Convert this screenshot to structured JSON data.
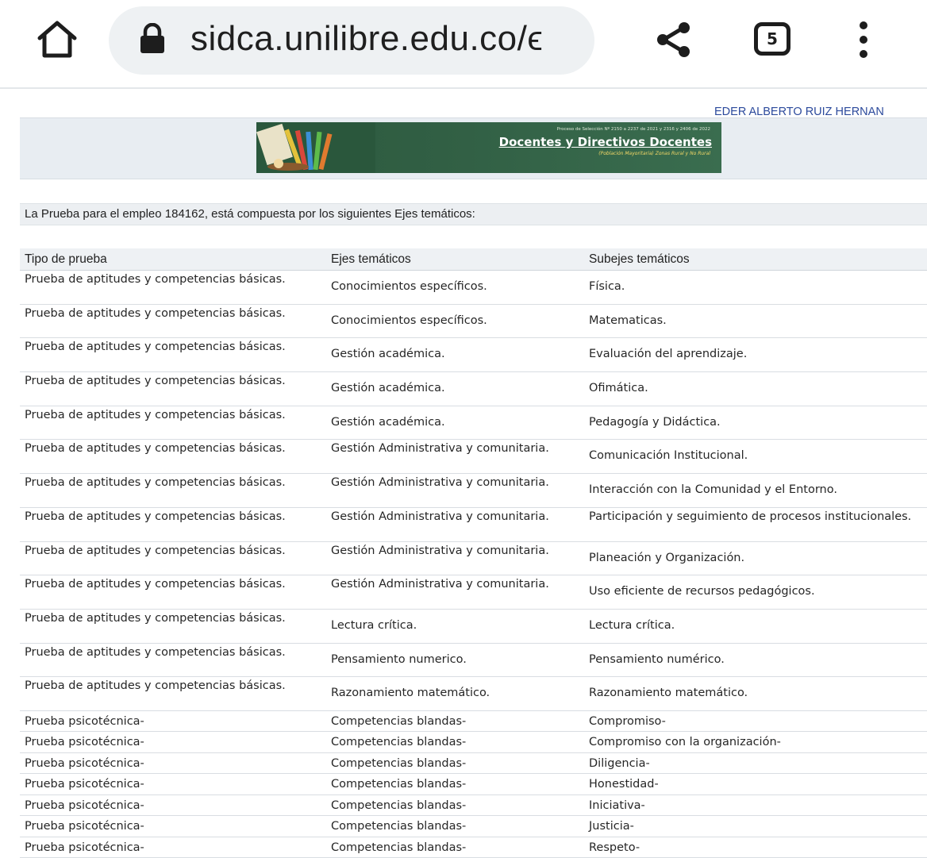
{
  "browser": {
    "url": "sidca.unilibre.edu.co/ϵ",
    "tab_count": "5",
    "icons": [
      "home-icon",
      "lock-icon",
      "share-icon",
      "tabs-icon",
      "more-vert-icon"
    ]
  },
  "header": {
    "user_name": "EDER ALBERTO RUIZ HERNAN",
    "banner": {
      "line1": "Proceso de Selección Nº 2150 a 2237 de 2021 y 2316 y 2406 de 2022",
      "title": "Docentes y Directivos Docentes",
      "subtitle_a": "(Población Mayoritaria)",
      "subtitle_b": "Zonas Rural y No Rural"
    }
  },
  "intro_text": "La Prueba para el empleo 184162, está compuesta por los siguientes Ejes temáticos:",
  "table": {
    "headers": [
      "Tipo de prueba",
      "Ejes temáticos",
      "Subejes temáticos"
    ],
    "rows": [
      {
        "tipo": "Prueba de aptitudes y competencias básicas.",
        "eje": "Conocimientos específicos.",
        "subeje": "Física."
      },
      {
        "tipo": "Prueba de aptitudes y competencias básicas.",
        "eje": "Conocimientos específicos.",
        "subeje": "Matematicas."
      },
      {
        "tipo": "Prueba de aptitudes y competencias básicas.",
        "eje": "Gestión académica.",
        "subeje": "Evaluación del aprendizaje."
      },
      {
        "tipo": "Prueba de aptitudes y competencias básicas.",
        "eje": "Gestión académica.",
        "subeje": "Ofimática."
      },
      {
        "tipo": "Prueba de aptitudes y competencias básicas.",
        "eje": "Gestión académica.",
        "subeje": "Pedagogía y Didáctica."
      },
      {
        "tipo": "Prueba de aptitudes y competencias básicas.",
        "eje": "Gestión Administrativa y comunitaria.",
        "subeje": "Comunicación Institucional."
      },
      {
        "tipo": "Prueba de aptitudes y competencias básicas.",
        "eje": "Gestión Administrativa y comunitaria.",
        "subeje": "Interacción con la Comunidad y el Entorno."
      },
      {
        "tipo": "Prueba de aptitudes y competencias básicas.",
        "eje": "Gestión Administrativa y comunitaria.",
        "subeje": "Participación y seguimiento de procesos institucionales."
      },
      {
        "tipo": "Prueba de aptitudes y competencias básicas.",
        "eje": "Gestión Administrativa y comunitaria.",
        "subeje": "Planeación y Organización."
      },
      {
        "tipo": "Prueba de aptitudes y competencias básicas.",
        "eje": "Gestión Administrativa y comunitaria.",
        "subeje": "Uso eficiente de recursos pedagógicos."
      },
      {
        "tipo": "Prueba de aptitudes y competencias básicas.",
        "eje": "Lectura crítica.",
        "subeje": "Lectura crítica."
      },
      {
        "tipo": "Prueba de aptitudes y competencias básicas.",
        "eje": "Pensamiento numerico.",
        "subeje": "Pensamiento numérico."
      },
      {
        "tipo": "Prueba de aptitudes y competencias básicas.",
        "eje": "Razonamiento matemático.",
        "subeje": "Razonamiento matemático."
      },
      {
        "tipo": "Prueba psicotécnica-",
        "eje": "Competencias blandas-",
        "subeje": "Compromiso-"
      },
      {
        "tipo": "Prueba psicotécnica-",
        "eje": "Competencias blandas-",
        "subeje": "Compromiso con la organización-"
      },
      {
        "tipo": "Prueba psicotécnica-",
        "eje": "Competencias blandas-",
        "subeje": "Diligencia-"
      },
      {
        "tipo": "Prueba psicotécnica-",
        "eje": "Competencias blandas-",
        "subeje": "Honestidad-"
      },
      {
        "tipo": "Prueba psicotécnica-",
        "eje": "Competencias blandas-",
        "subeje": "Iniciativa-"
      },
      {
        "tipo": "Prueba psicotécnica-",
        "eje": "Competencias blandas-",
        "subeje": "Justicia-"
      },
      {
        "tipo": "Prueba psicotécnica-",
        "eje": "Competencias blandas-",
        "subeje": "Respeto-"
      }
    ]
  }
}
